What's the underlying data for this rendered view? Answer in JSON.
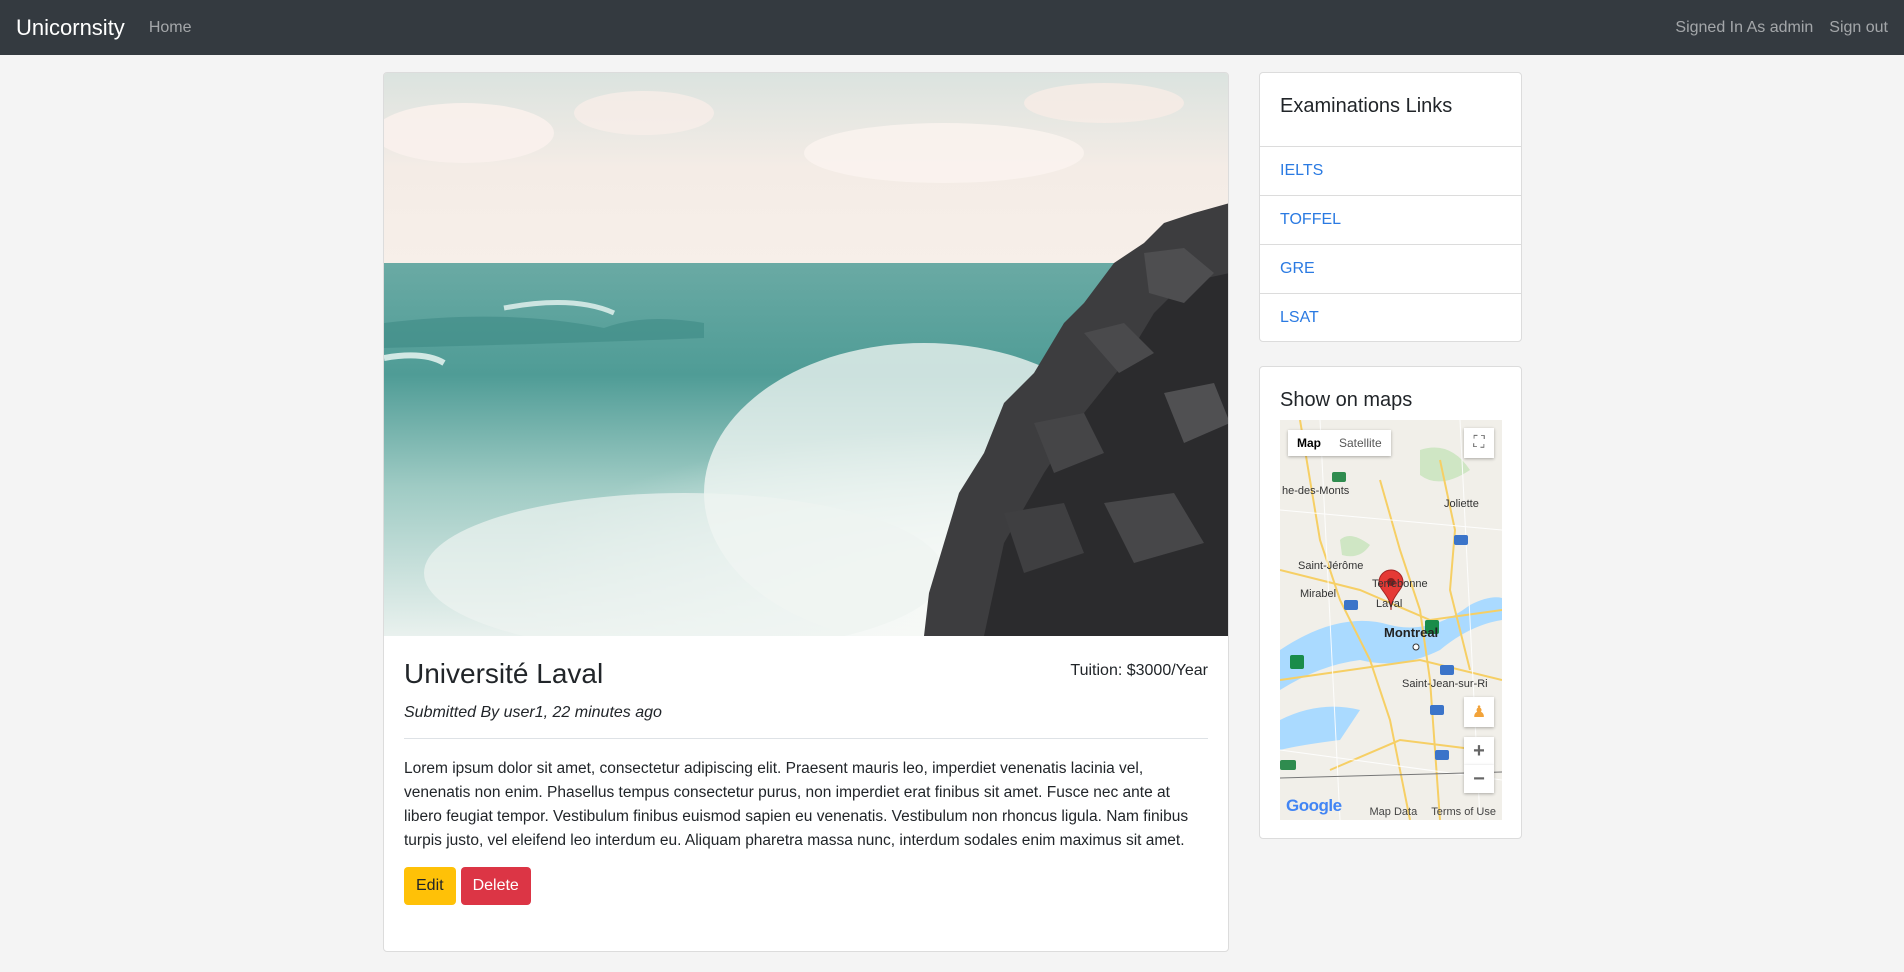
{
  "navbar": {
    "brand": "Unicornsity",
    "home": "Home",
    "signed_in": "Signed In As admin",
    "sign_out": "Sign out"
  },
  "post": {
    "title": "Université Laval",
    "tuition": "Tuition: $3000/Year",
    "submitted": "Submitted By user1, 22 minutes ago",
    "description": "Lorem ipsum dolor sit amet, consectetur adipiscing elit. Praesent mauris leo, imperdiet venenatis lacinia vel, venenatis non enim. Phasellus tempus consectetur purus, non imperdiet erat finibus sit amet. Fusce nec ante at libero feugiat tempor. Vestibulum finibus euismod sapien eu venenatis. Vestibulum non rhoncus ligula. Nam finibus turpis justo, vel eleifend leo interdum eu. Aliquam pharetra massa nunc, interdum sodales enim maximus sit amet.",
    "edit_label": "Edit",
    "delete_label": "Delete"
  },
  "exam_links": {
    "title": "Examinations Links",
    "items": [
      "IELTS",
      "TOFFEL",
      "GRE",
      "LSAT"
    ]
  },
  "map": {
    "title": "Show on maps",
    "type_map": "Map",
    "type_satellite": "Satellite",
    "google": "Google",
    "map_data": "Map Data",
    "terms": "Terms of Use",
    "labels": {
      "montreal": "Montreal",
      "laval": "Laval",
      "terrebonne": "Terrebonne",
      "mirabel": "Mirabel",
      "saint_jerome": "Saint-Jérôme",
      "joliette": "Joliette",
      "saint_jean": "Saint-Jean-sur-Ri",
      "des_monts": "he-des-Monts"
    }
  },
  "colors": {
    "navbar": "#343a40",
    "edit": "#ffc107",
    "delete": "#dc3545",
    "link": "#2a7ae2"
  }
}
